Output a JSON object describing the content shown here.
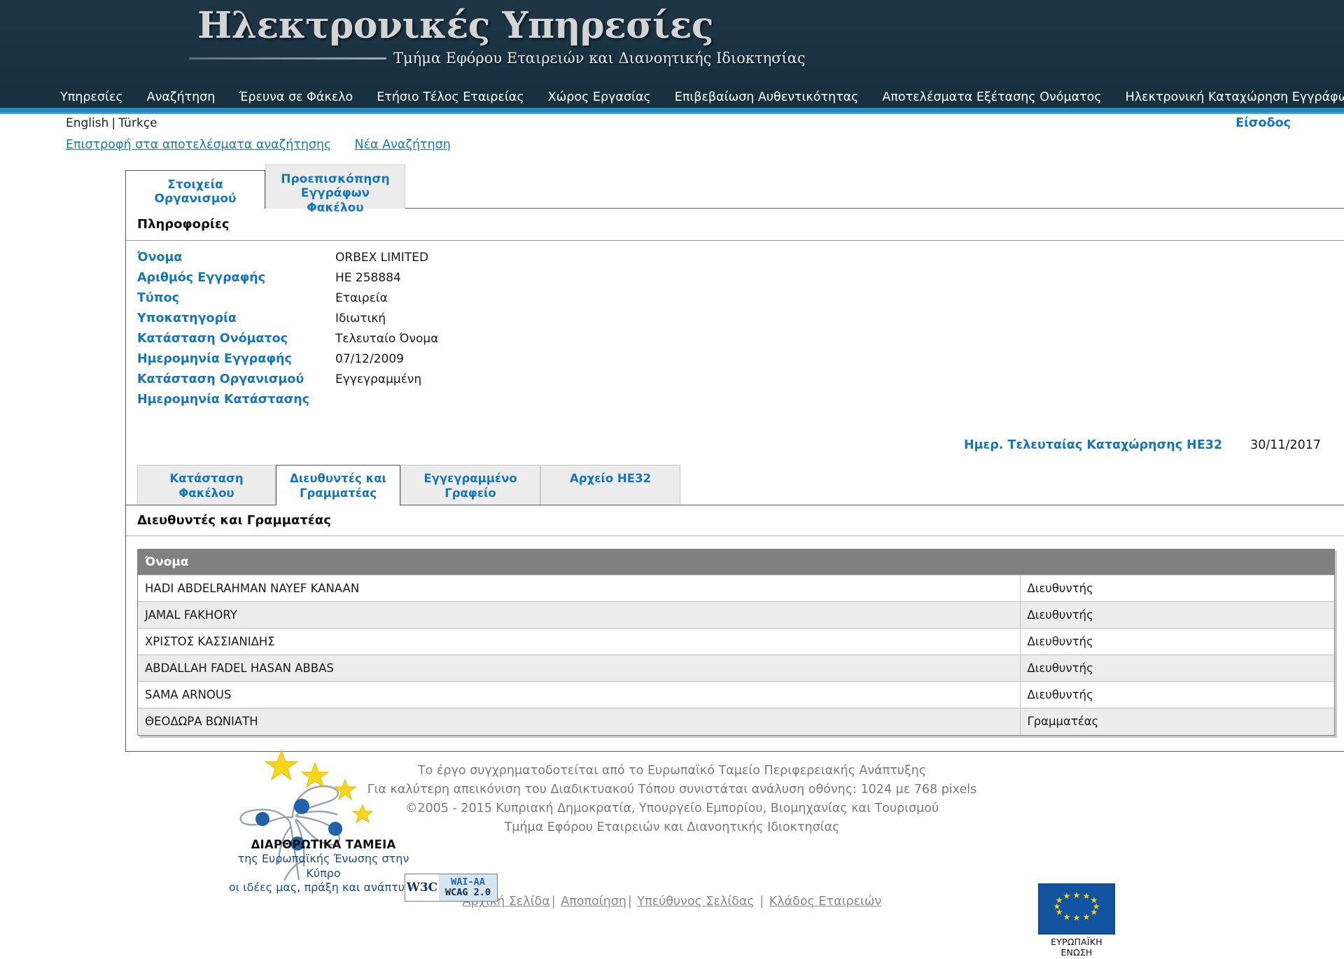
{
  "header": {
    "title": "Ηλεκτρονικές Υπηρεσίες",
    "subtitle": "Τμήμα Εφόρου Εταιρειών και Διανοητικής Ιδιοκτησίας",
    "nav": [
      "Υπηρεσίες",
      "Αναζήτηση",
      "Έρευνα σε Φάκελο",
      "Ετήσιο Τέλος Εταιρείας",
      "Χώρος Εργασίας",
      "Επιβεβαίωση Αυθεντικότητας",
      "Αποτελέσματα Εξέτασης Ονόματος",
      "Ηλεκτρονική Καταχώρηση Εγγράφων"
    ],
    "accent_color": "#2592cc",
    "background_color": "#1b3242"
  },
  "langbar": {
    "english": "English",
    "separator": "|",
    "turkce": "Türkçe",
    "login": "Είσοδος"
  },
  "crumbs": {
    "back_to_results": "Επιστροφή στα αποτελέσματα αναζήτησης",
    "new_search": "Νέα Αναζήτηση"
  },
  "tabs": {
    "details": "Στοιχεία Οργανισμού",
    "preview_line1": "Προεπισκόπηση",
    "preview_line2": "Εγγράφων Φακέλου"
  },
  "info": {
    "panel_title": "Πληροφορίες",
    "rows": [
      {
        "label": "Όνομα",
        "value": "ORBEX LIMITED"
      },
      {
        "label": "Αριθμός Εγγραφής",
        "value": "ΗΕ 258884"
      },
      {
        "label": "Τύπος",
        "value": "Εταιρεία"
      },
      {
        "label": "Υποκατηγορία",
        "value": "Ιδιωτική"
      },
      {
        "label": "Κατάσταση Ονόματος",
        "value": "Τελευταίο Όνομα"
      },
      {
        "label": "Ημερομηνία Εγγραφής",
        "value": "07/12/2009"
      },
      {
        "label": "Κατάσταση Οργανισμού",
        "value": "Εγγεγραμμένη"
      },
      {
        "label": "Ημερομηνία Κατάστασης",
        "value": ""
      }
    ],
    "last_entry_label": "Ημερ. Τελευταίας Καταχώρησης ΗΕ32",
    "last_entry_value": "30/11/2017"
  },
  "subtabs": {
    "file_status": "Κατάσταση Φακέλου",
    "directors_line1": "Διευθυντές και",
    "directors_line2": "Γραμματέας",
    "registered_office": "Εγγεγραμμένο Γραφείο",
    "he32_archive": "Αρχείο ΗΕ32"
  },
  "directors": {
    "panel_title": "Διευθυντές και Γραμματέας",
    "columns": [
      "Όνομα",
      ""
    ],
    "rows": [
      {
        "name": "HADI ABDELRAHMAN NAYEF KANAAN",
        "role": "Διευθυντής"
      },
      {
        "name": "JAMAL FAKHORY",
        "role": "Διευθυντής"
      },
      {
        "name": "ΧΡΙΣΤΟΣ ΚΑΣΣΙΑΝΙΔΗΣ",
        "role": "Διευθυντής"
      },
      {
        "name": "ABDALLAH FADEL HASAN ABBAS",
        "role": "Διευθυντής"
      },
      {
        "name": "SAMA ARNOUS",
        "role": "Διευθυντής"
      },
      {
        "name": "ΘΕΟΔΩΡΑ ΒΩΝΙΑΤΗ",
        "role": "Γραμματέας"
      }
    ]
  },
  "footer": {
    "line1": "Το έργο συγχρηματοδοτείται από το Ευρωπαϊκό Ταμείο Περιφερειακής Ανάπτυξης",
    "line2": "Για καλύτερη απεικόνιση του Διαδικτυακού Τόπου συνιστάται ανάλυση οθόνης: 1024 με 768 pixels",
    "line3": "©2005 - 2015 Κυπριακή Δημοκρατία, Υπουργείο Εμπορίου, Βιομηχανίας και Τουρισμού",
    "line4": "Τμήμα Εφόρου Εταιρειών και Διανοητικής Ιδιοκτησίας",
    "links": [
      "Αρχική Σελίδα",
      "Αποποίηση",
      "Υπεύθυνος Σελίδας",
      "Κλάδος Εταιρειών"
    ],
    "structural_funds": {
      "line1": "ΔΙΑΡΘΡΩΤΙΚΑ ΤΑΜΕΙΑ",
      "line2": "της Ευρωπαϊκής Ένωσης στην Κύπρο",
      "line3": "οι ιδέες μας, πράξη και ανάπτυξη"
    },
    "wcag": {
      "w3c": "W3C",
      "line1": "WAI-AA",
      "line2": "WCAG 2.0"
    },
    "eu_flag_caption": "ΕΥΡΩΠΑΪΚΗ ΕΝΩΣΗ"
  }
}
